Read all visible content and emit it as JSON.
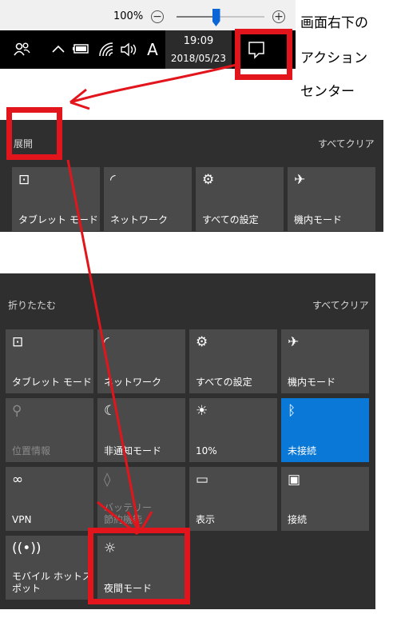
{
  "zoom": {
    "label": "100%",
    "minus": "−",
    "plus": "+",
    "level_percent": 45
  },
  "taskbar": {
    "people_icon": "people-icon",
    "chevron": "^",
    "battery_icon": "battery-icon",
    "wifi_icon": "wifi-icon",
    "volume_icon": "volume-icon",
    "ime": "A",
    "time": "19:09",
    "date": "2018/05/23",
    "action_center_icon": "action-center-icon"
  },
  "annotation": {
    "line1": "画面右下の",
    "line2": "アクション",
    "line3": "センター"
  },
  "panel1": {
    "left_label": "展開",
    "right_label": "すべてクリア",
    "tiles": [
      {
        "icon": "tablet-mode-icon",
        "glyph": "⊡",
        "label": "タブレット モード"
      },
      {
        "icon": "network-icon",
        "glyph": "◜",
        "label": "ネットワーク"
      },
      {
        "icon": "settings-icon",
        "glyph": "⚙",
        "label": "すべての設定"
      },
      {
        "icon": "airplane-icon",
        "glyph": "✈",
        "label": "機内モード"
      }
    ]
  },
  "panel2": {
    "left_label": "折りたたむ",
    "right_label": "すべてクリア",
    "tiles": [
      {
        "icon": "tablet-mode-icon",
        "glyph": "⊡",
        "label": "タブレット モード"
      },
      {
        "icon": "network-icon",
        "glyph": "◜",
        "label": "ネットワーク"
      },
      {
        "icon": "settings-icon",
        "glyph": "⚙",
        "label": "すべての設定"
      },
      {
        "icon": "airplane-icon",
        "glyph": "✈",
        "label": "機内モード"
      },
      {
        "icon": "location-icon",
        "glyph": "⚲",
        "label": "位置情報"
      },
      {
        "icon": "quiet-hours-icon",
        "glyph": "☾",
        "label": "非通知モード"
      },
      {
        "icon": "brightness-icon",
        "glyph": "☀",
        "label": "10%"
      },
      {
        "icon": "bluetooth-icon",
        "glyph": "ᛒ",
        "label": "未接続"
      },
      {
        "icon": "vpn-icon",
        "glyph": "∞",
        "label": "VPN"
      },
      {
        "icon": "battery-saver-icon",
        "glyph": "◊",
        "label": "バッテリー\n節約機能"
      },
      {
        "icon": "project-icon",
        "glyph": "▭",
        "label": "表示"
      },
      {
        "icon": "connect-icon",
        "glyph": "▣",
        "label": "接続"
      },
      {
        "icon": "mobile-hotspot-icon",
        "glyph": "((•))",
        "label": "モバイル ホットス\nポット"
      },
      {
        "icon": "night-light-icon",
        "glyph": "☼",
        "label": "夜間モード"
      }
    ]
  }
}
